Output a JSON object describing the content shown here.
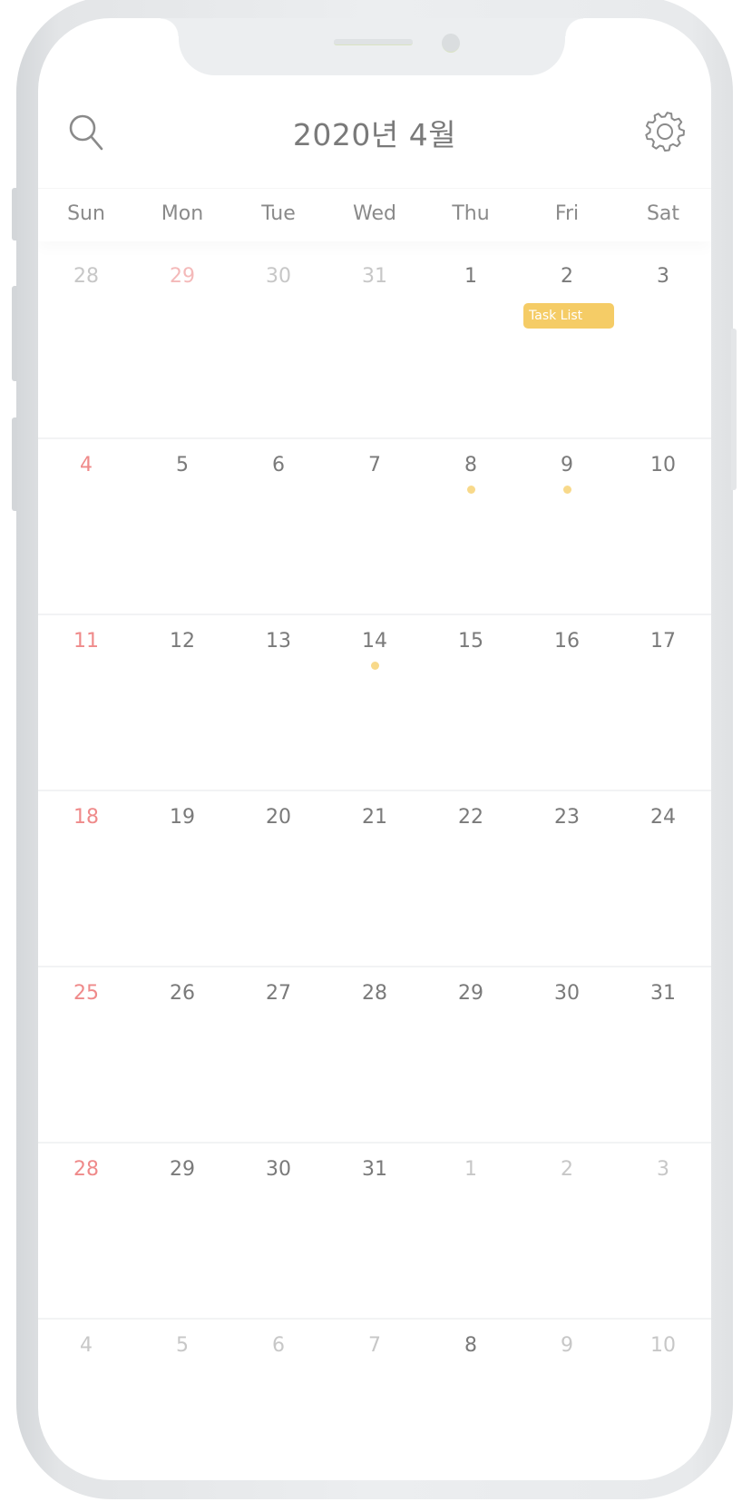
{
  "header": {
    "title": "2020년 4월",
    "search_icon": "search-icon",
    "settings_icon": "gear-icon"
  },
  "colors": {
    "sunday": "#ef8a8a",
    "event_dot": "#f8d98a",
    "task_chip": "#f5cc66",
    "text": "#7a7a7a",
    "muted_text": "#c7c7c7"
  },
  "weekdays": [
    "Sun",
    "Mon",
    "Tue",
    "Wed",
    "Thu",
    "Fri",
    "Sat"
  ],
  "weeks": [
    [
      {
        "day": "28",
        "state": "other"
      },
      {
        "day": "29",
        "state": "other-red"
      },
      {
        "day": "30",
        "state": "other"
      },
      {
        "day": "31",
        "state": "other"
      },
      {
        "day": "1",
        "state": "current"
      },
      {
        "day": "2",
        "state": "current",
        "task": "Task List"
      },
      {
        "day": "3",
        "state": "current"
      }
    ],
    [
      {
        "day": "4",
        "state": "sunday"
      },
      {
        "day": "5",
        "state": "current"
      },
      {
        "day": "6",
        "state": "current"
      },
      {
        "day": "7",
        "state": "current"
      },
      {
        "day": "8",
        "state": "current",
        "dot": true
      },
      {
        "day": "9",
        "state": "current",
        "dot": true
      },
      {
        "day": "10",
        "state": "current"
      }
    ],
    [
      {
        "day": "11",
        "state": "sunday"
      },
      {
        "day": "12",
        "state": "current"
      },
      {
        "day": "13",
        "state": "current"
      },
      {
        "day": "14",
        "state": "current",
        "dot": true
      },
      {
        "day": "15",
        "state": "current"
      },
      {
        "day": "16",
        "state": "current"
      },
      {
        "day": "17",
        "state": "current"
      }
    ],
    [
      {
        "day": "18",
        "state": "sunday"
      },
      {
        "day": "19",
        "state": "current"
      },
      {
        "day": "20",
        "state": "current"
      },
      {
        "day": "21",
        "state": "current"
      },
      {
        "day": "22",
        "state": "current"
      },
      {
        "day": "23",
        "state": "current"
      },
      {
        "day": "24",
        "state": "current"
      }
    ],
    [
      {
        "day": "25",
        "state": "sunday"
      },
      {
        "day": "26",
        "state": "current"
      },
      {
        "day": "27",
        "state": "current"
      },
      {
        "day": "28",
        "state": "current"
      },
      {
        "day": "29",
        "state": "current"
      },
      {
        "day": "30",
        "state": "current"
      },
      {
        "day": "31",
        "state": "current"
      }
    ],
    [
      {
        "day": "28",
        "state": "sunday"
      },
      {
        "day": "29",
        "state": "current"
      },
      {
        "day": "30",
        "state": "current"
      },
      {
        "day": "31",
        "state": "current"
      },
      {
        "day": "1",
        "state": "other"
      },
      {
        "day": "2",
        "state": "other"
      },
      {
        "day": "3",
        "state": "other"
      }
    ],
    [
      {
        "day": "4",
        "state": "other"
      },
      {
        "day": "5",
        "state": "other"
      },
      {
        "day": "6",
        "state": "other"
      },
      {
        "day": "7",
        "state": "other"
      },
      {
        "day": "8",
        "state": "current"
      },
      {
        "day": "9",
        "state": "other"
      },
      {
        "day": "10",
        "state": "other"
      }
    ]
  ]
}
